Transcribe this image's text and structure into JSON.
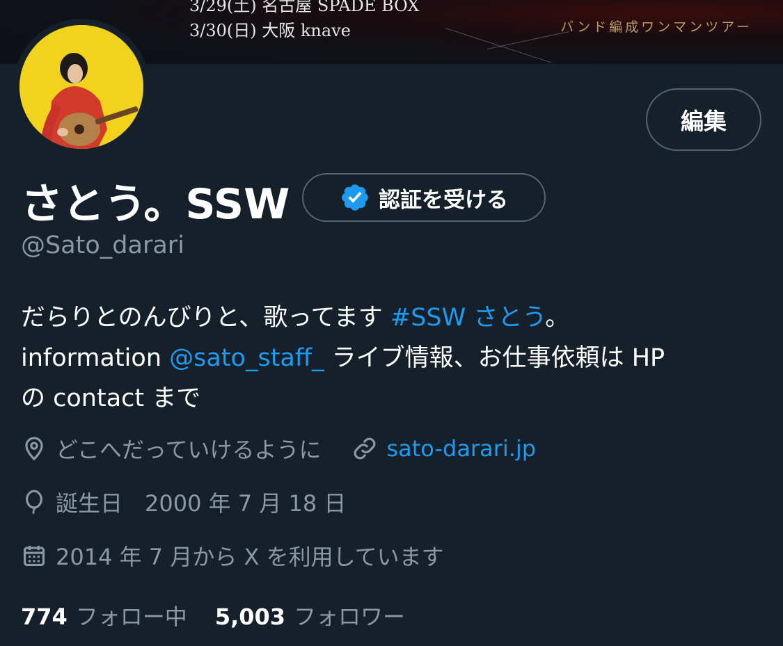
{
  "banner": {
    "line1": "3/29(土) 名古屋 SPADE BOX",
    "line2": "3/30(日) 大阪 knave",
    "subtitle": "バンド編成ワンマンツアー"
  },
  "header": {
    "edit_label": "編集"
  },
  "profile": {
    "display_name": "さとう。SSW",
    "verify_label": "認証を受ける",
    "handle": "@Sato_darari",
    "bio": {
      "line1_text": "だらりとのんびりと、歌ってます ",
      "line1_hashtag": "#SSW さとう",
      "line1_end": "。",
      "line2_text": "information ",
      "line2_mention": "@sato_staff_",
      "line2_end": " ライブ情報、お仕事依頼は HP",
      "line3_text": "の contact まで"
    },
    "location": "どこへだっていけるように",
    "website": "sato-darari.jp",
    "birthday": "誕生日　2000 年 7 月 18 日",
    "joined": "2014 年 7 月から X を利用しています"
  },
  "stats": {
    "following_count": "774",
    "following_label": "フォロー中",
    "followers_count": "5,003",
    "followers_label": "フォロワー"
  },
  "colors": {
    "background": "#15202b",
    "link": "#1d9bf0",
    "secondary_text": "#8b98a5",
    "border": "#536471",
    "avatar_bg": "#f1d21d"
  }
}
